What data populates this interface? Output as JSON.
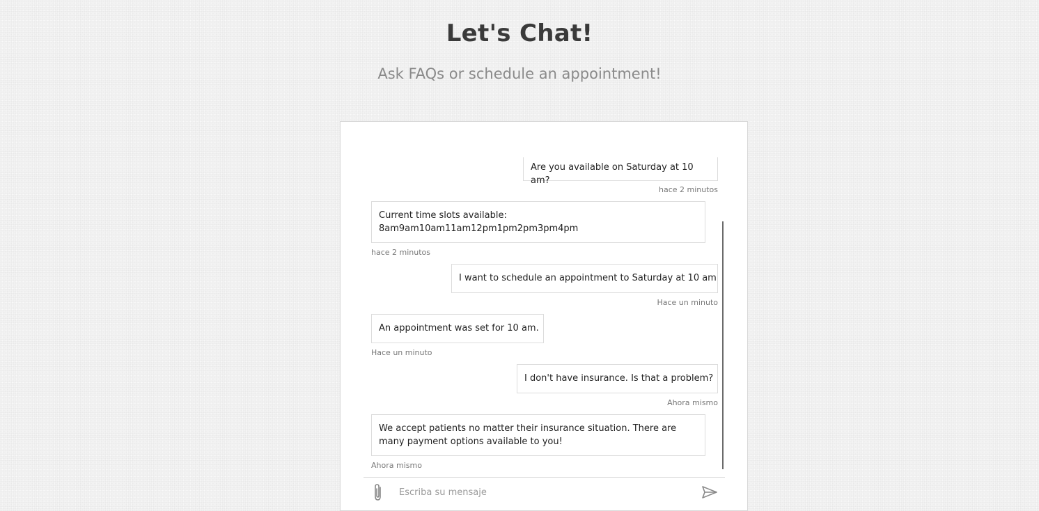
{
  "header": {
    "title": "Let's Chat!",
    "subtitle": "Ask FAQs or schedule an appointment!"
  },
  "chat": {
    "messages": [
      {
        "sender": "user",
        "text": "Are you available on Saturday at 10 am?",
        "time": "hace 2 minutos"
      },
      {
        "sender": "bot",
        "text": "Current time slots available:\n8am9am10am11am12pm1pm2pm3pm4pm",
        "time": "hace 2 minutos"
      },
      {
        "sender": "user",
        "text": "I want to schedule an appointment to Saturday at 10 am",
        "time": "Hace un minuto"
      },
      {
        "sender": "bot",
        "text": "An appointment was set for 10 am.",
        "time": "Hace un minuto"
      },
      {
        "sender": "user",
        "text": "I don't have insurance. Is that a problem?",
        "time": "Ahora mismo"
      },
      {
        "sender": "bot",
        "text": "We accept patients no matter their insurance situation. There are\nmany payment options available to you!",
        "time": "Ahora mismo"
      }
    ]
  },
  "composer": {
    "placeholder": "Escriba su mensaje",
    "value": "",
    "attach_icon": "paperclip-icon",
    "send_icon": "send-icon"
  },
  "colors": {
    "page_background": "#f2f2f2",
    "card_background": "#ffffff",
    "bubble_border": "#dcdcdc",
    "text": "#222222",
    "timestamp": "#777777",
    "icon": "#888888"
  }
}
